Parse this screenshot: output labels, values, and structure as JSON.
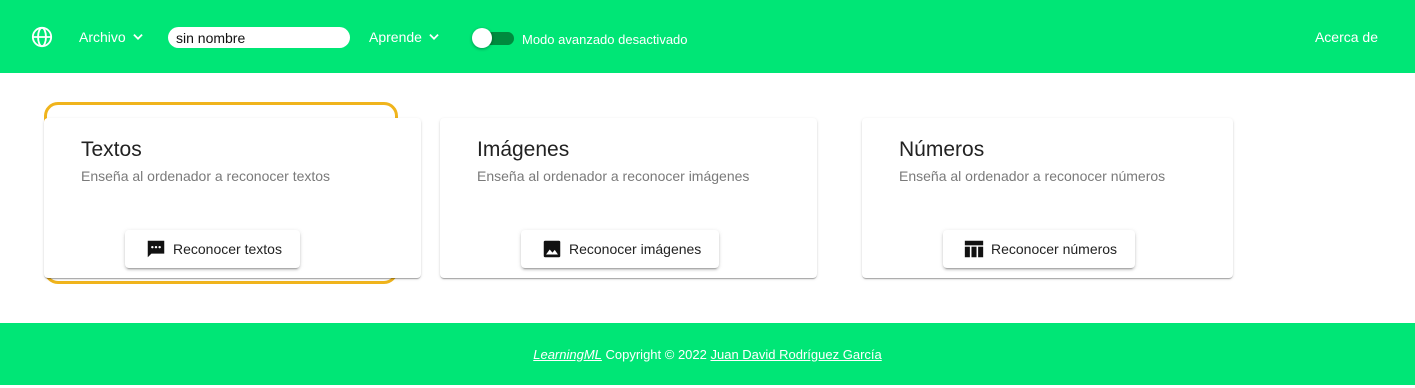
{
  "header": {
    "menu_file": "Archivo",
    "project_name": "sin nombre",
    "menu_learn": "Aprende",
    "advanced_mode": false,
    "advanced_mode_label": "Modo avanzado desactivado",
    "about": "Acerca de",
    "icons": [
      "globe-icon",
      "chevron-down-icon"
    ]
  },
  "cards": [
    {
      "title": "Textos",
      "subtitle": "Enseña al ordenador a reconocer textos",
      "button": "Reconocer textos",
      "icon": "message-icon",
      "focused": true
    },
    {
      "title": "Imágenes",
      "subtitle": "Enseña al ordenador a reconocer imágenes",
      "button": "Reconocer imágenes",
      "icon": "image-icon",
      "focused": false
    },
    {
      "title": "Números",
      "subtitle": "Enseña al ordenador a reconocer números",
      "button": "Reconocer números",
      "icon": "table-icon",
      "focused": false
    }
  ],
  "footer": {
    "brand": "LearningML",
    "copyright": " Copyright © 2022 ",
    "author": "Juan David Rodríguez García"
  },
  "colors": {
    "primary": "#00e676",
    "focus": "#f0b41c",
    "toggle_track": "#008a3e"
  }
}
